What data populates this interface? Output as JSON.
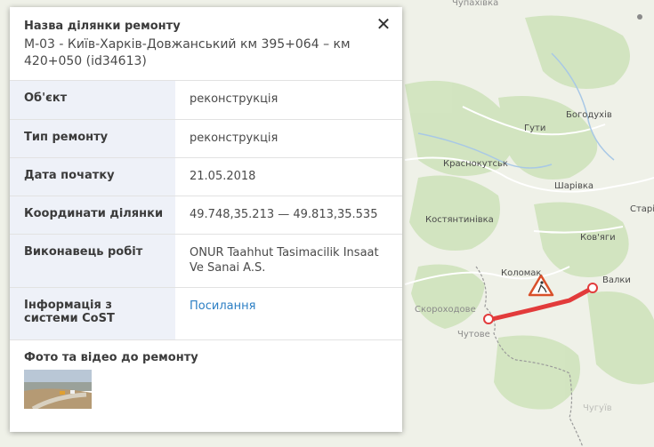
{
  "panel": {
    "label": "Назва ділянки ремонту",
    "title": "М-03 - Київ-Харків-Довжанський км 395+064 – км 420+050 (id34613)",
    "close_icon": "close-icon",
    "rows": [
      {
        "key": "Об'єкт",
        "value": "реконструкція"
      },
      {
        "key": "Тип ремонту",
        "value": "реконструкція"
      },
      {
        "key": "Дата початку",
        "value": "21.05.2018"
      },
      {
        "key": "Координати ділянки",
        "value": "49.748,35.213 — 49.813,35.535"
      },
      {
        "key": "Виконавець робіт",
        "value": "ONUR Taahhut Tasimacilik Insaat Ve Sanai A.S."
      },
      {
        "key": "Інформація з системи CoST",
        "value": "Посилання"
      }
    ],
    "photo_label": "Фото та відео до ремонту"
  },
  "map": {
    "towns": {
      "chupakhivka": "Чупахівка",
      "bohodukhiv": "Богодухів",
      "huty": "Гути",
      "krasnokutsk": "Краснокутськ",
      "sharivka": "Шарівка",
      "kostiantynivka": "Костянтинівка",
      "stari": "Старі",
      "kovyahy": "Ков'яги",
      "kolomak": "Коломак",
      "valky": "Валки",
      "skorokhodove": "Скороходове",
      "chutove": "Чутове",
      "watermark": "Чугуїв"
    },
    "road_color": "#e23b3b",
    "repair_icon": "roadwork-warning-icon"
  }
}
